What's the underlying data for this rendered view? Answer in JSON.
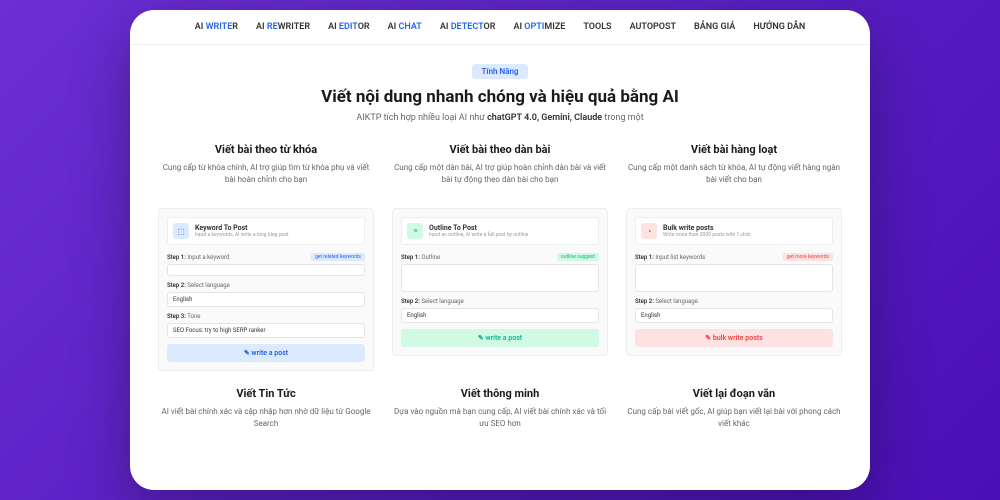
{
  "nav": [
    {
      "pre": "AI ",
      "accent": "WRITE",
      "post": "R"
    },
    {
      "pre": "AI ",
      "accent": "RE",
      "post": "WRITER"
    },
    {
      "pre": "AI ",
      "accent": "EDIT",
      "post": "OR"
    },
    {
      "pre": "AI ",
      "accent": "CHAT",
      "post": ""
    },
    {
      "pre": "AI ",
      "accent": "DETECT",
      "post": "OR"
    },
    {
      "pre": "AI ",
      "accent": "OPTI",
      "post": "MIZE"
    },
    {
      "pre": "",
      "accent": "",
      "post": "TOOLS"
    },
    {
      "pre": "",
      "accent": "",
      "post": "AUTOPOST"
    },
    {
      "pre": "",
      "accent": "",
      "post": "BẢNG GIÁ"
    },
    {
      "pre": "",
      "accent": "",
      "post": "HƯỚNG DẪN"
    }
  ],
  "hero": {
    "badge": "Tính Năng",
    "title": "Viết nội dung nhanh chóng và hiệu quả bằng AI",
    "sub_pre": "AIKTP tích hợp nhiều loại AI như ",
    "sub_hl": "chatGPT 4.0, Gemini, Claude",
    "sub_post": " trong một"
  },
  "cards": [
    {
      "title": "Viết bài theo từ khóa",
      "desc": "Cung cấp từ khóa chính, AI trợ giúp tìm từ khóa phụ và viết bài hoàn chỉnh cho bạn",
      "icon": "⬚",
      "iconClass": "blue",
      "ptitle": "Keyword To Post",
      "psub": "Input a keywords, AI write a long blog post",
      "step1": "Input a keyword",
      "tag": "get related keywords",
      "tagClass": "blue",
      "fieldTall": false,
      "step2": "Select language",
      "lang": "English",
      "step3": "Tone",
      "tone": "SEO Focus: try to high SERP ranker",
      "btn": "✎ write a post",
      "btnClass": "blue"
    },
    {
      "title": "Viết bài theo dàn bài",
      "desc": "Cung cấp một dàn bài, AI trợ giúp hoàn chỉnh dàn bài và viết bài tự động theo dàn bài cho bạn",
      "icon": "≡",
      "iconClass": "green",
      "ptitle": "Outline To Post",
      "psub": "Input an outline, AI write a full post by outline",
      "step1": "Outline",
      "tag": "outline suggest",
      "tagClass": "green",
      "fieldTall": true,
      "step2": "Select language",
      "lang": "English",
      "step3": "",
      "tone": "",
      "btn": "✎ write a post",
      "btnClass": "green"
    },
    {
      "title": "Viết bài hàng loạt",
      "desc": "Cung cấp một danh sách từ khóa, AI tự động viết hàng ngàn bài viết cho bạn",
      "icon": "◔",
      "iconClass": "red",
      "ptitle": "Bulk write posts",
      "psub": "Write more than 2000 posts with 1 click",
      "step1": "Input list keywords",
      "tag": "get more keywords",
      "tagClass": "red",
      "fieldTall": true,
      "step2": "Select language",
      "lang": "English",
      "step3": "",
      "tone": "",
      "btn": "✎ bulk write posts",
      "btnClass": "red"
    }
  ],
  "row2": [
    {
      "title": "Viết Tin Tức",
      "desc": "AI viết bài chính xác và cập nhập hơn nhờ dữ liệu từ Google Search"
    },
    {
      "title": "Viết thông minh",
      "desc": "Dựa vào nguồn mà bạn cung cấp, AI viết bài chính xác và tối ưu SEO hơn"
    },
    {
      "title": "Viết lại đoạn văn",
      "desc": "Cung cấp bài viết gốc, AI giúp bạn viết lại bài với phong cách viết khác"
    }
  ]
}
